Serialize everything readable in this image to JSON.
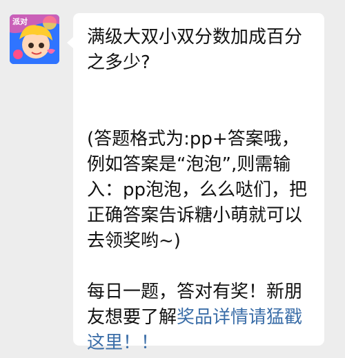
{
  "chat": {
    "avatar_icon": "game-character-avatar-icon",
    "avatar_badge_text": "派对",
    "message": {
      "question": "满级大双小双分数加成百分之多少?",
      "format_hint": "(答题格式为:pp+答案哦，例如答案是“泡泡”,则需输入：pp泡泡，么么哒们，把正确答案告诉糖小萌就可以去领奖哟~)",
      "reward_text": "每日一题，答对有奖！新朋友想要了解",
      "link_text": "奖品详情请猛戳这里！！"
    },
    "colors": {
      "background": "#ededed",
      "bubble": "#ffffff",
      "text": "#111111",
      "link": "#3b6ea8"
    }
  }
}
